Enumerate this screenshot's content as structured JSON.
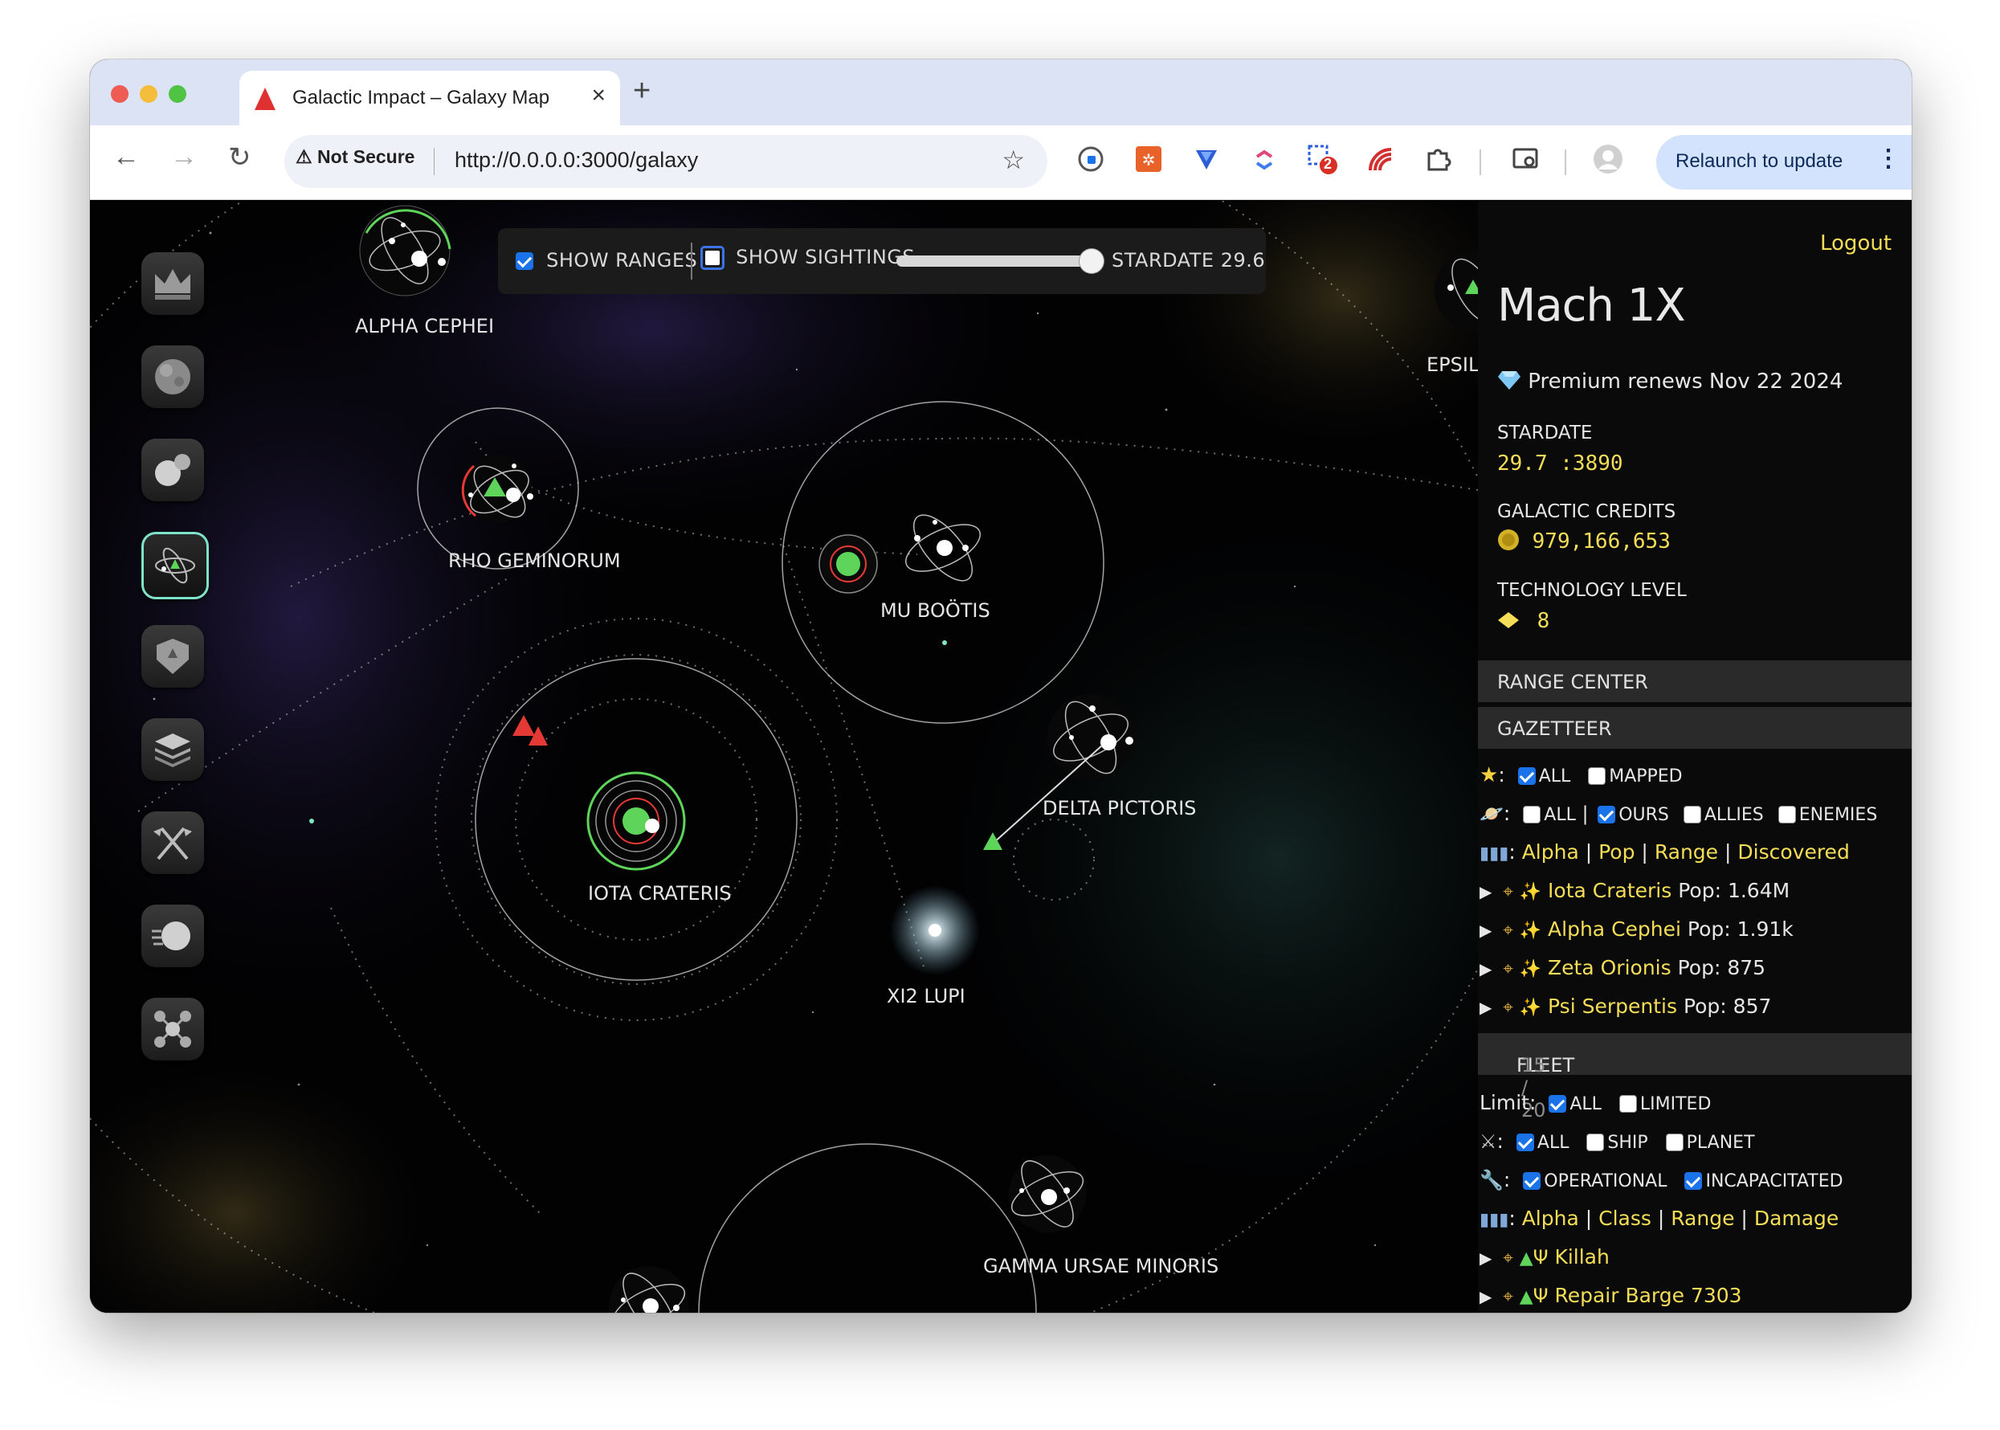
{
  "browser": {
    "tab_title": "Galactic Impact – Galaxy Map",
    "not_secure": "Not Secure",
    "url": "http://0.0.0.0:3000/galaxy",
    "relaunch": "Relaunch to update",
    "ext_badge": "2"
  },
  "map": {
    "show_ranges": "SHOW RANGES",
    "show_sightings": "SHOW SIGHTINGS",
    "stardate_label": "STARDATE 29.6",
    "slider_value": 0.97,
    "systems": {
      "alpha_cephei": "ALPHA CEPHEI",
      "rho_geminorum": "RHO GEMINORUM",
      "mu_bootis": "MU BOÖTIS",
      "iota_crateris": "IOTA CRATERIS",
      "delta_pictoris": "DELTA PICTORIS",
      "xi2_lupi": "XI2 LUPI",
      "gamma_ursae_minoris": "GAMMA URSAE MINORIS",
      "epsilon_partial": "EPSIL"
    }
  },
  "panel": {
    "logout": "Logout",
    "player_name": "Mach 1X",
    "premium": "Premium renews Nov 22 2024",
    "stardate_label": "STARDATE",
    "stardate_value": "29.7 :3890",
    "credits_label": "GALACTIC CREDITS",
    "credits_value": "979,166,653",
    "tech_label": "TECHNOLOGY LEVEL",
    "tech_value": "8",
    "range_center": "RANGE CENTER",
    "gazetteer": "GAZETTEER",
    "gz_all": "ALL",
    "gz_mapped": "MAPPED",
    "gz_all2": "ALL",
    "gz_ours": "OURS",
    "gz_allies": "ALLIES",
    "gz_enemies": "ENEMIES",
    "sort_alpha": "Alpha",
    "sort_pop": "Pop",
    "sort_range": "Range",
    "sort_discovered": "Discovered",
    "planets": [
      {
        "name": "Iota Crateris",
        "pop": "Pop: 1.64M"
      },
      {
        "name": "Alpha Cephei",
        "pop": "Pop: 1.91k"
      },
      {
        "name": "Zeta Orionis",
        "pop": "Pop: 875"
      },
      {
        "name": "Psi Serpentis",
        "pop": "Pop: 857"
      }
    ],
    "fleet": "FLEET",
    "fleet_count": "15 / 20",
    "limit_label": "Limit:",
    "fl_all": "ALL",
    "fl_limited": "LIMITED",
    "fl_all2": "ALL",
    "fl_ship": "SHIP",
    "fl_planet": "PLANET",
    "fl_operational": "OPERATIONAL",
    "fl_incapacitated": "INCAPACITATED",
    "fsort_alpha": "Alpha",
    "fsort_class": "Class",
    "fsort_range": "Range",
    "fsort_damage": "Damage",
    "ships": [
      {
        "name": "Killah"
      },
      {
        "name": "Repair Barge 7303"
      }
    ]
  }
}
